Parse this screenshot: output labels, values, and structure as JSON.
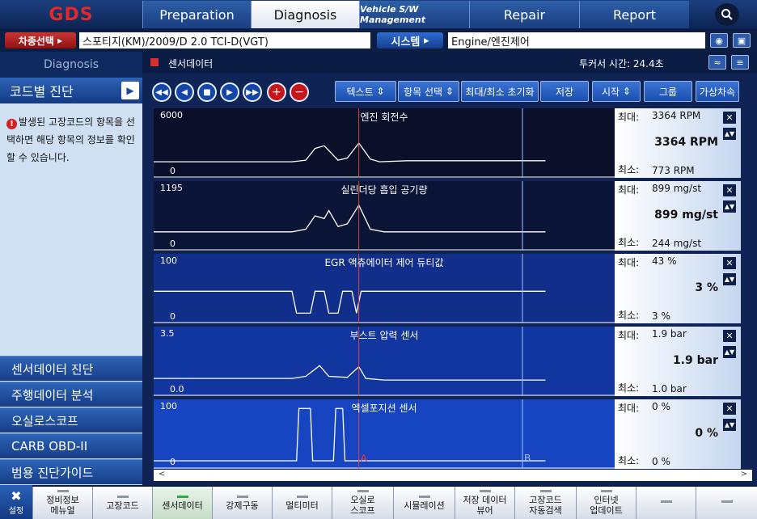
{
  "nav": {
    "logo": "GDS",
    "tabs": [
      {
        "label": "Preparation"
      },
      {
        "label": "Diagnosis"
      },
      {
        "label": "Vehicle S/W Management"
      },
      {
        "label": "Repair"
      },
      {
        "label": "Report"
      }
    ]
  },
  "vehicle": {
    "select_label": "차종선택",
    "select_value": "스포티지(KM)/2009/D 2.0 TCI-D(VGT)",
    "system_label": "시스템",
    "system_value": "Engine/엔진제어"
  },
  "left": {
    "title": "Diagnosis",
    "code_diag": "코드별 진단",
    "info": "발생된 고장코드의 항목을 선택하면 해당 항목의 정보를 확인 할 수 있습니다.",
    "menu": [
      "센서데이터 진단",
      "주행데이터 분석",
      "오실로스코프",
      "CARB OBD-II",
      "범용 진단가이드"
    ]
  },
  "main": {
    "title": "센서데이터",
    "trigger_time": "투커서 시간: 24.4초",
    "toolbar": {
      "text_label": "텍스트",
      "item_select_label": "항목 선택",
      "minmax_reset_label": "최대/최소 초기화",
      "save_label": "저장",
      "start_label": "시작",
      "group_label": "그룹",
      "virtual_accel_label": "가상차속"
    },
    "graphs": [
      {
        "title": "엔진 회전수",
        "scale_max": "6000",
        "scale_min": "0",
        "max_label": "최대:",
        "max_value": "3364 RPM",
        "current": "3364 RPM",
        "min_label": "최소:",
        "min_value": "773 RPM",
        "current_fraction": 0.56
      },
      {
        "title": "실린더당 흡입 공기량",
        "scale_max": "1195",
        "scale_min": "0",
        "max_label": "최대:",
        "max_value": "899 mg/st",
        "current": "899 mg/st",
        "min_label": "최소:",
        "min_value": "244 mg/st",
        "current_fraction": 0.75
      },
      {
        "title": "EGR 액츄에이터 제어 듀티값",
        "scale_max": "100",
        "scale_min": "0",
        "max_label": "최대:",
        "max_value": "43 %",
        "current": "3 %",
        "min_label": "최소:",
        "min_value": "3 %",
        "current_fraction": 0.03
      },
      {
        "title": "부스트 압력 센서",
        "scale_max": "3.5",
        "scale_min": "0.0",
        "max_label": "최대:",
        "max_value": "1.9 bar",
        "current": "1.9 bar",
        "min_label": "최소:",
        "min_value": "1.0 bar",
        "current_fraction": 0.54
      },
      {
        "title": "엑셀포지션 센서",
        "scale_max": "100",
        "scale_min": "0",
        "max_label": "최대:",
        "max_value": "0 %",
        "current": "0 %",
        "min_label": "최소:",
        "min_value": "0 %",
        "current_fraction": 0.0
      }
    ],
    "cursor_a": "A",
    "cursor_b": "B"
  },
  "bottom": {
    "settings_label": "설정",
    "buttons": [
      {
        "line1": "정비정보",
        "line2": "메뉴얼"
      },
      {
        "line1": "고장코드",
        "line2": ""
      },
      {
        "line1": "센서데이터",
        "line2": ""
      },
      {
        "line1": "강제구동",
        "line2": ""
      },
      {
        "line1": "멀티미터",
        "line2": ""
      },
      {
        "line1": "오실로",
        "line2": "스코프"
      },
      {
        "line1": "시뮬레이션",
        "line2": ""
      },
      {
        "line1": "저장 데이터",
        "line2": "뷰어"
      },
      {
        "line1": "고장코드",
        "line2": "자동검색"
      },
      {
        "line1": "인터넷",
        "line2": "업데이트"
      }
    ]
  },
  "colors": {
    "accent_red": "#d83030",
    "active_indicator": "#23b04a",
    "graph_line": "#ffffff",
    "cursor_a": "#e04040",
    "cursor_b": "#9fc2ff"
  }
}
